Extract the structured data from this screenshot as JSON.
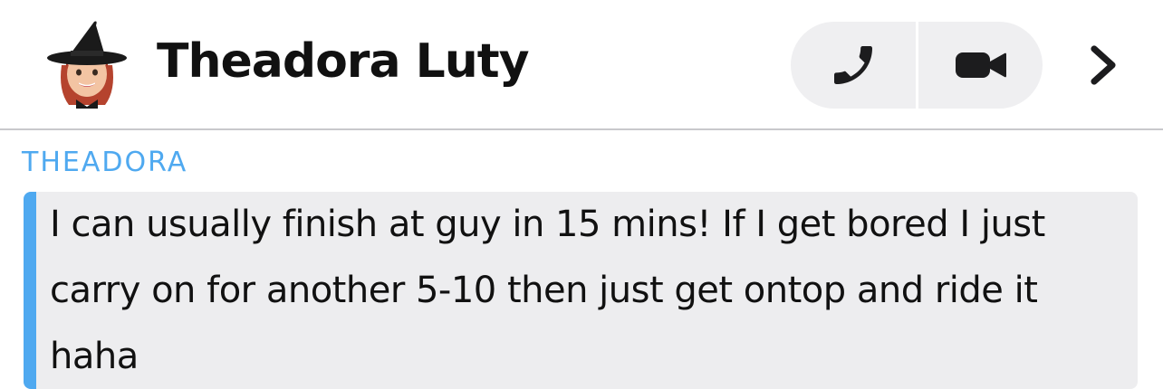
{
  "header": {
    "contact_name": "Theadora Luty",
    "avatar_icon": "bitmoji-witch-avatar",
    "actions": {
      "call_icon": "phone-icon",
      "video_icon": "video-camera-icon",
      "more_icon": "chevron-right-icon"
    }
  },
  "conversation": {
    "messages": [
      {
        "sender": "THEADORA",
        "text": "I can usually finish at guy in 15 mins! If I get bored I just carry on for another 5-10 then just get ontop and ride it haha"
      }
    ]
  },
  "colors": {
    "accent": "#4fa9f0",
    "bubble_bg": "#ededef",
    "button_bg": "#efeff1",
    "text": "#111111"
  }
}
